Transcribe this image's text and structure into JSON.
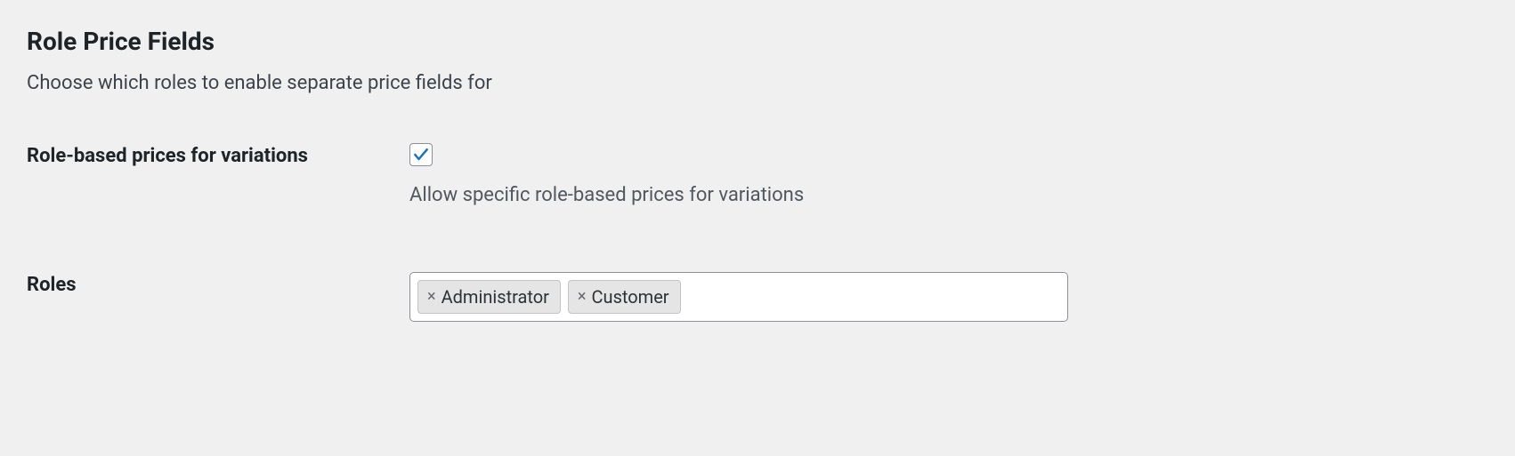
{
  "section": {
    "title": "Role Price Fields",
    "description": "Choose which roles to enable separate price fields for"
  },
  "fields": {
    "variations": {
      "label": "Role-based prices for variations",
      "checked": true,
      "description": "Allow specific role-based prices for variations"
    },
    "roles": {
      "label": "Roles",
      "selected": [
        "Administrator",
        "Customer"
      ]
    }
  },
  "colors": {
    "check": "#2271b1"
  }
}
